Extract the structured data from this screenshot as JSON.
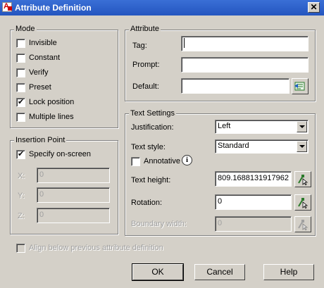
{
  "window": {
    "title": "Attribute Definition"
  },
  "mode": {
    "label": "Mode",
    "items": [
      {
        "label": "Invisible",
        "checked": false
      },
      {
        "label": "Constant",
        "checked": false
      },
      {
        "label": "Verify",
        "checked": false
      },
      {
        "label": "Preset",
        "checked": false
      },
      {
        "label": "Lock position",
        "checked": true
      },
      {
        "label": "Multiple lines",
        "checked": false
      }
    ]
  },
  "attribute": {
    "label": "Attribute",
    "tag_label": "Tag:",
    "tag_value": "",
    "prompt_label": "Prompt:",
    "prompt_value": "",
    "default_label": "Default:",
    "default_value": ""
  },
  "insertion_point": {
    "label": "Insertion Point",
    "specify_label": "Specify on-screen",
    "specify_checked": true,
    "x_label": "X:",
    "x_value": "0",
    "y_label": "Y:",
    "y_value": "0",
    "z_label": "Z:",
    "z_value": "0"
  },
  "text_settings": {
    "label": "Text Settings",
    "justification_label": "Justification:",
    "justification_value": "Left",
    "text_style_label": "Text style:",
    "text_style_value": "Standard",
    "annotative_label": "Annotative",
    "annotative_checked": false,
    "text_height_label": "Text height:",
    "text_height_value": "809.1688131917962",
    "rotation_label": "Rotation:",
    "rotation_value": "0",
    "boundary_width_label": "Boundary width:",
    "boundary_width_value": "0"
  },
  "align_below": {
    "label": "Align below previous attribute definition",
    "checked": false
  },
  "buttons": {
    "ok": "OK",
    "cancel": "Cancel",
    "help": "Help"
  }
}
